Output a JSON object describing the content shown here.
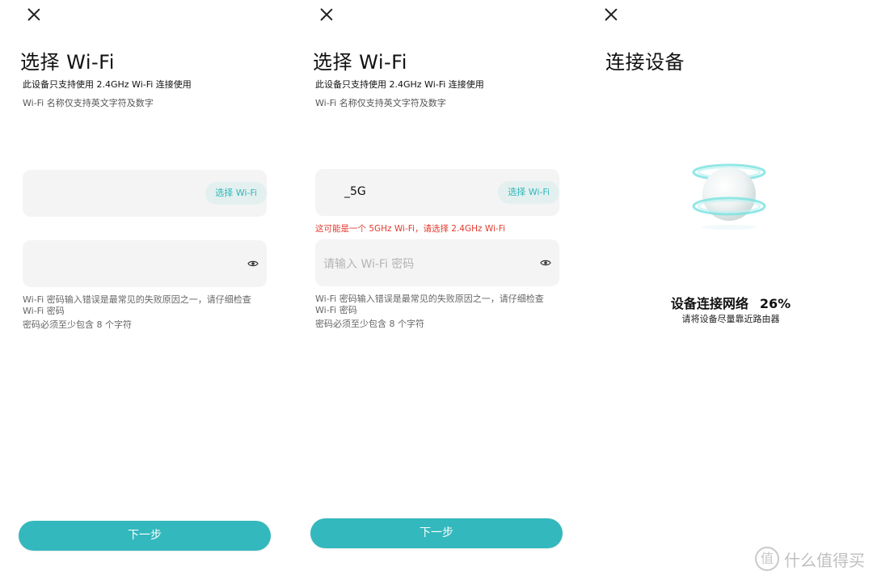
{
  "screen1": {
    "title": "选择 Wi-Fi",
    "subtitle1": "此设备只支持使用 2.4GHz Wi-Fi 连接使用",
    "subtitle2": "Wi-Fi 名称仅支持英文字符及数字",
    "ssid_value": "",
    "select_wifi_label": "选择 Wi-Fi",
    "password_placeholder": "",
    "hint1": "Wi-Fi 密码输入错误是最常见的失败原因之一，请仔细检查 Wi-Fi 密码",
    "hint2": "密码必须至少包含 8 个字符",
    "next_label": "下一步"
  },
  "screen2": {
    "title": "选择 Wi-Fi",
    "subtitle1": "此设备只支持使用 2.4GHz Wi-Fi 连接使用",
    "subtitle2": "Wi-Fi 名称仅支持英文字符及数字",
    "ssid_value": "_5G",
    "select_wifi_label": "选择 Wi-Fi",
    "warning": "这可能是一个 5GHz Wi-Fi，请选择 2.4GHz Wi-Fi",
    "password_placeholder": "请输入 Wi-Fi 密码",
    "hint1": "Wi-Fi 密码输入错误是最常见的失败原因之一，请仔细检查 Wi-Fi 密码",
    "hint2": "密码必须至少包含 8 个字符",
    "next_label": "下一步"
  },
  "screen3": {
    "title": "连接设备",
    "status_label": "设备连接网络",
    "progress_percent": "26%",
    "hint": "请将设备尽量靠近路由器"
  },
  "watermark": {
    "badge": "值",
    "text": "什么值得买"
  },
  "colors": {
    "accent": "#33b8bd",
    "warning": "#e23b2f",
    "field_bg": "#f4f4f4",
    "pill_bg": "#e3f0ef"
  },
  "icons": {
    "close": "close-icon",
    "eye": "eye-icon",
    "orb": "device-orb-icon"
  }
}
